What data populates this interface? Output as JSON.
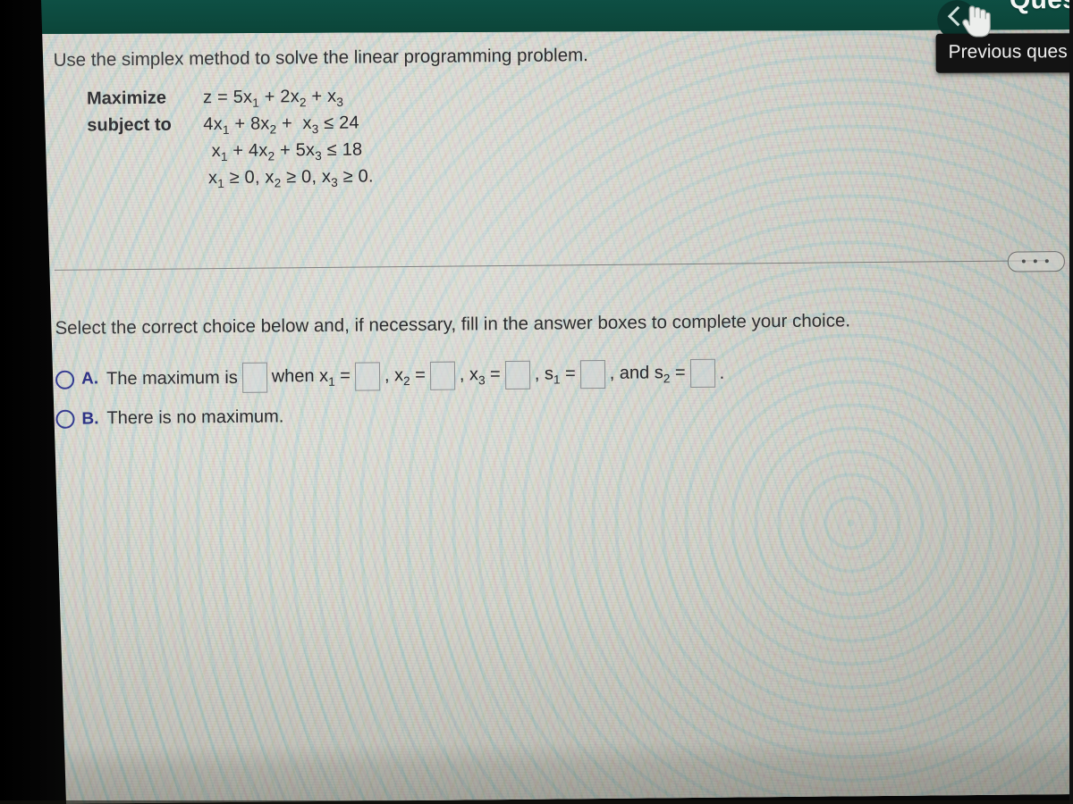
{
  "app": {
    "title": "Questio",
    "back_icon": "chevron-left-icon",
    "cursor_icon": "pointing-hand-cursor"
  },
  "tooltip": {
    "label": "Previous ques"
  },
  "problem": {
    "prompt": "Use the simplex method to solve the linear programming problem.",
    "maximize_label": "Maximize",
    "subject_to_label": "subject to",
    "objective": "z = 5x₁ + 2x₂ + x₃",
    "constraints": [
      "4x₁ + 8x₂ +  x₃ ≤ 24",
      "x₁ + 4x₂ + 5x₃ ≤ 18",
      "x₁ ≥ 0, x₂ ≥ 0, x₃ ≥ 0."
    ]
  },
  "instruction": "Select the correct choice below and, if necessary, fill in the answer boxes to complete your choice.",
  "choices": [
    {
      "letter": "A.",
      "selected": false,
      "text_before": "The maximum is",
      "segments": [
        "when x₁ =",
        ", x₂ =",
        ", x₃ =",
        ", s₁ =",
        ", and s₂ =",
        "."
      ],
      "box_values": [
        "",
        "",
        "",
        "",
        "",
        ""
      ]
    },
    {
      "letter": "B.",
      "selected": false,
      "text_before": "There is no maximum.",
      "segments": [],
      "box_values": []
    }
  ],
  "more_button": {
    "icon": "ellipsis-icon",
    "label": "..."
  },
  "colors": {
    "header_green": "#0d4a40",
    "tooltip_black": "#131313",
    "choice_blue": "#22277f",
    "page_bg": "#d9dad2",
    "text": "#2a2a2c"
  }
}
